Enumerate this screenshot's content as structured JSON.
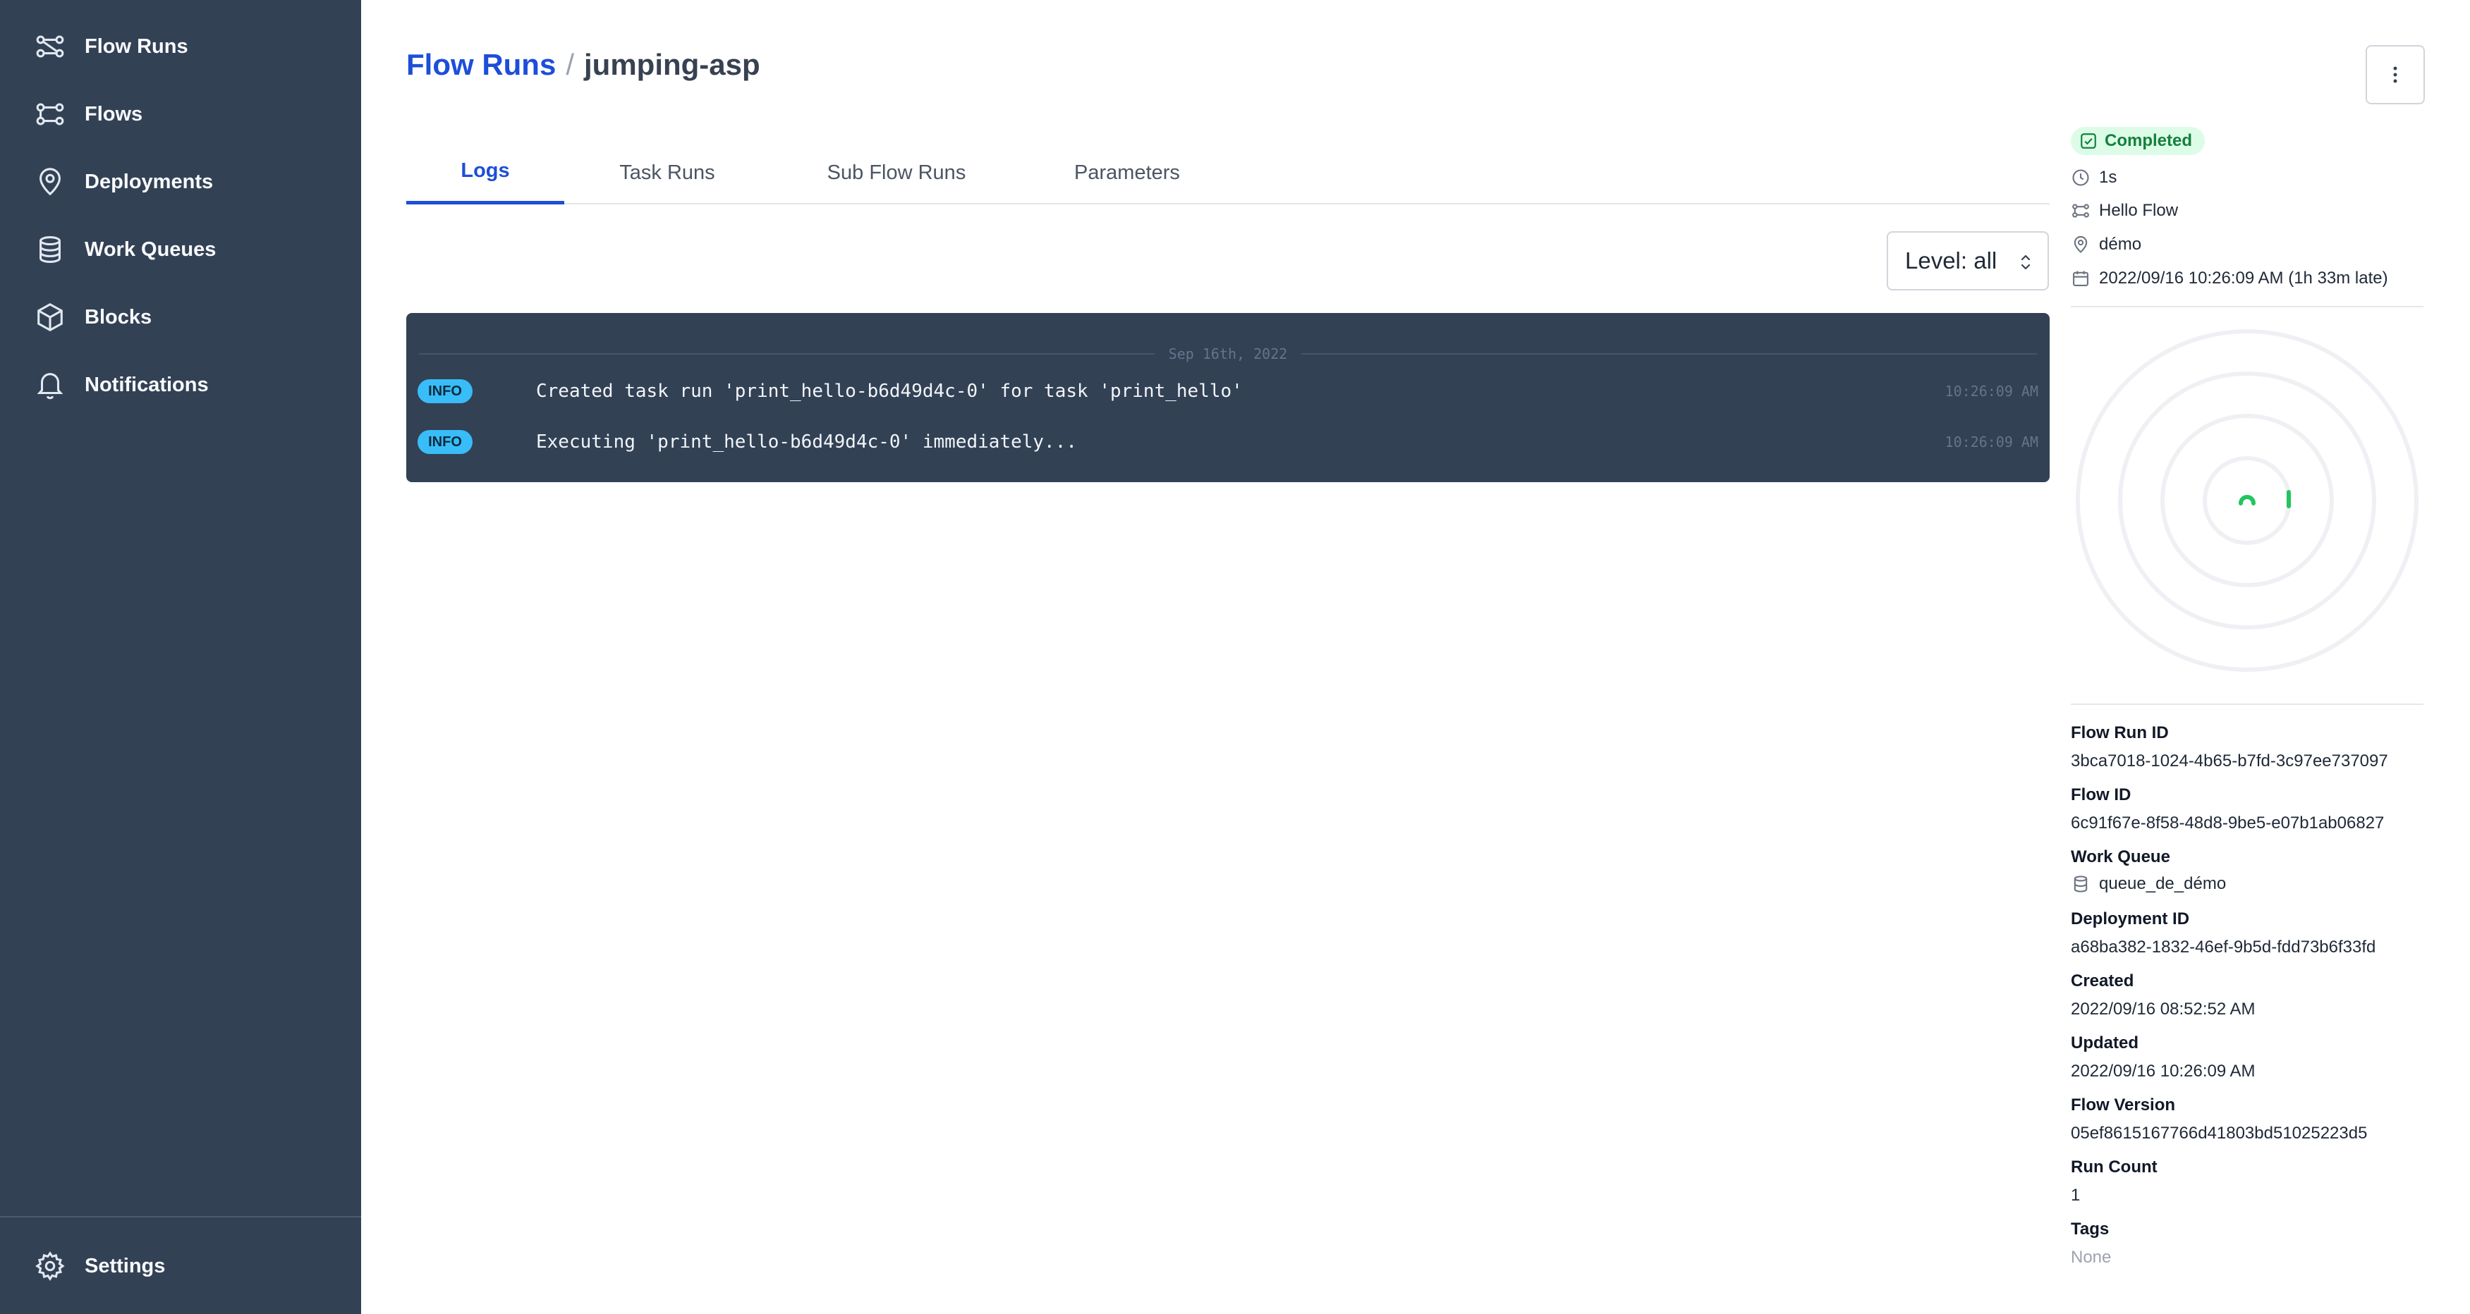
{
  "sidebar": {
    "items": [
      {
        "label": "Flow Runs",
        "icon": "flow-runs-icon"
      },
      {
        "label": "Flows",
        "icon": "flows-icon"
      },
      {
        "label": "Deployments",
        "icon": "deployments-icon"
      },
      {
        "label": "Work Queues",
        "icon": "work-queues-icon"
      },
      {
        "label": "Blocks",
        "icon": "blocks-icon"
      },
      {
        "label": "Notifications",
        "icon": "bell-icon"
      }
    ],
    "settings_label": "Settings"
  },
  "header": {
    "breadcrumb_root": "Flow Runs",
    "separator": "/",
    "current": "jumping-asp"
  },
  "tabs": [
    {
      "label": "Logs",
      "active": true
    },
    {
      "label": "Task Runs",
      "active": false
    },
    {
      "label": "Sub Flow Runs",
      "active": false
    },
    {
      "label": "Parameters",
      "active": false
    }
  ],
  "level_filter": {
    "value": "Level: all"
  },
  "logs": {
    "date": "Sep 16th, 2022",
    "entries": [
      {
        "level": "INFO",
        "message": "Created task run 'print_hello-b6d49d4c-0' for task 'print_hello'",
        "time": "10:26:09 AM"
      },
      {
        "level": "INFO",
        "message": "Executing 'print_hello-b6d49d4c-0' immediately...",
        "time": "10:26:09 AM"
      }
    ]
  },
  "summary": {
    "status": "Completed",
    "duration": "1s",
    "flow": "Hello Flow",
    "deployment": "démo",
    "scheduled": "2022/09/16 10:26:09 AM (1h 33m late)"
  },
  "details": {
    "flow_run_id_label": "Flow Run ID",
    "flow_run_id": "3bca7018-1024-4b65-b7fd-3c97ee737097",
    "flow_id_label": "Flow ID",
    "flow_id": "6c91f67e-8f58-48d8-9be5-e07b1ab06827",
    "work_queue_label": "Work Queue",
    "work_queue": "queue_de_démo",
    "deployment_id_label": "Deployment ID",
    "deployment_id": "a68ba382-1832-46ef-9b5d-fdd73b6f33fd",
    "created_label": "Created",
    "created": "2022/09/16 08:52:52 AM",
    "updated_label": "Updated",
    "updated": "2022/09/16 10:26:09 AM",
    "flow_version_label": "Flow Version",
    "flow_version": "05ef8615167766d41803bd51025223d5",
    "run_count_label": "Run Count",
    "run_count": "1",
    "tags_label": "Tags",
    "tags": "None"
  },
  "colors": {
    "sidebar_bg": "#334155",
    "accent": "#1d4ed8",
    "success": "#22c55e",
    "log_badge": "#38bdf8"
  }
}
